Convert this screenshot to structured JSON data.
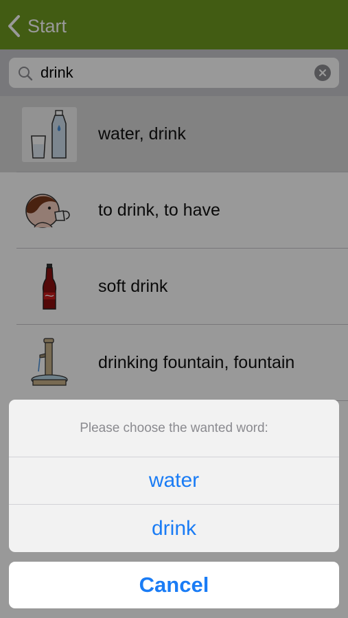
{
  "navbar": {
    "back_label": "Start",
    "color": "#6e9a21",
    "back_icon": "chevron-left-icon"
  },
  "search": {
    "value": "drink",
    "search_icon": "magnifier-icon",
    "clear_icon": "clear-x-icon"
  },
  "results": [
    {
      "label": "water, drink",
      "icon": "water-bottle-glass-icon",
      "selected": true
    },
    {
      "label": "to drink, to have",
      "icon": "person-drinking-icon",
      "selected": false
    },
    {
      "label": "soft drink",
      "icon": "soda-bottle-icon",
      "selected": false
    },
    {
      "label": "drinking fountain, fountain",
      "icon": "drinking-fountain-icon",
      "selected": false
    }
  ],
  "action_sheet": {
    "title": "Please choose the wanted word:",
    "options": [
      "water",
      "drink"
    ],
    "cancel_label": "Cancel",
    "accent_color": "#1a7cf5"
  }
}
